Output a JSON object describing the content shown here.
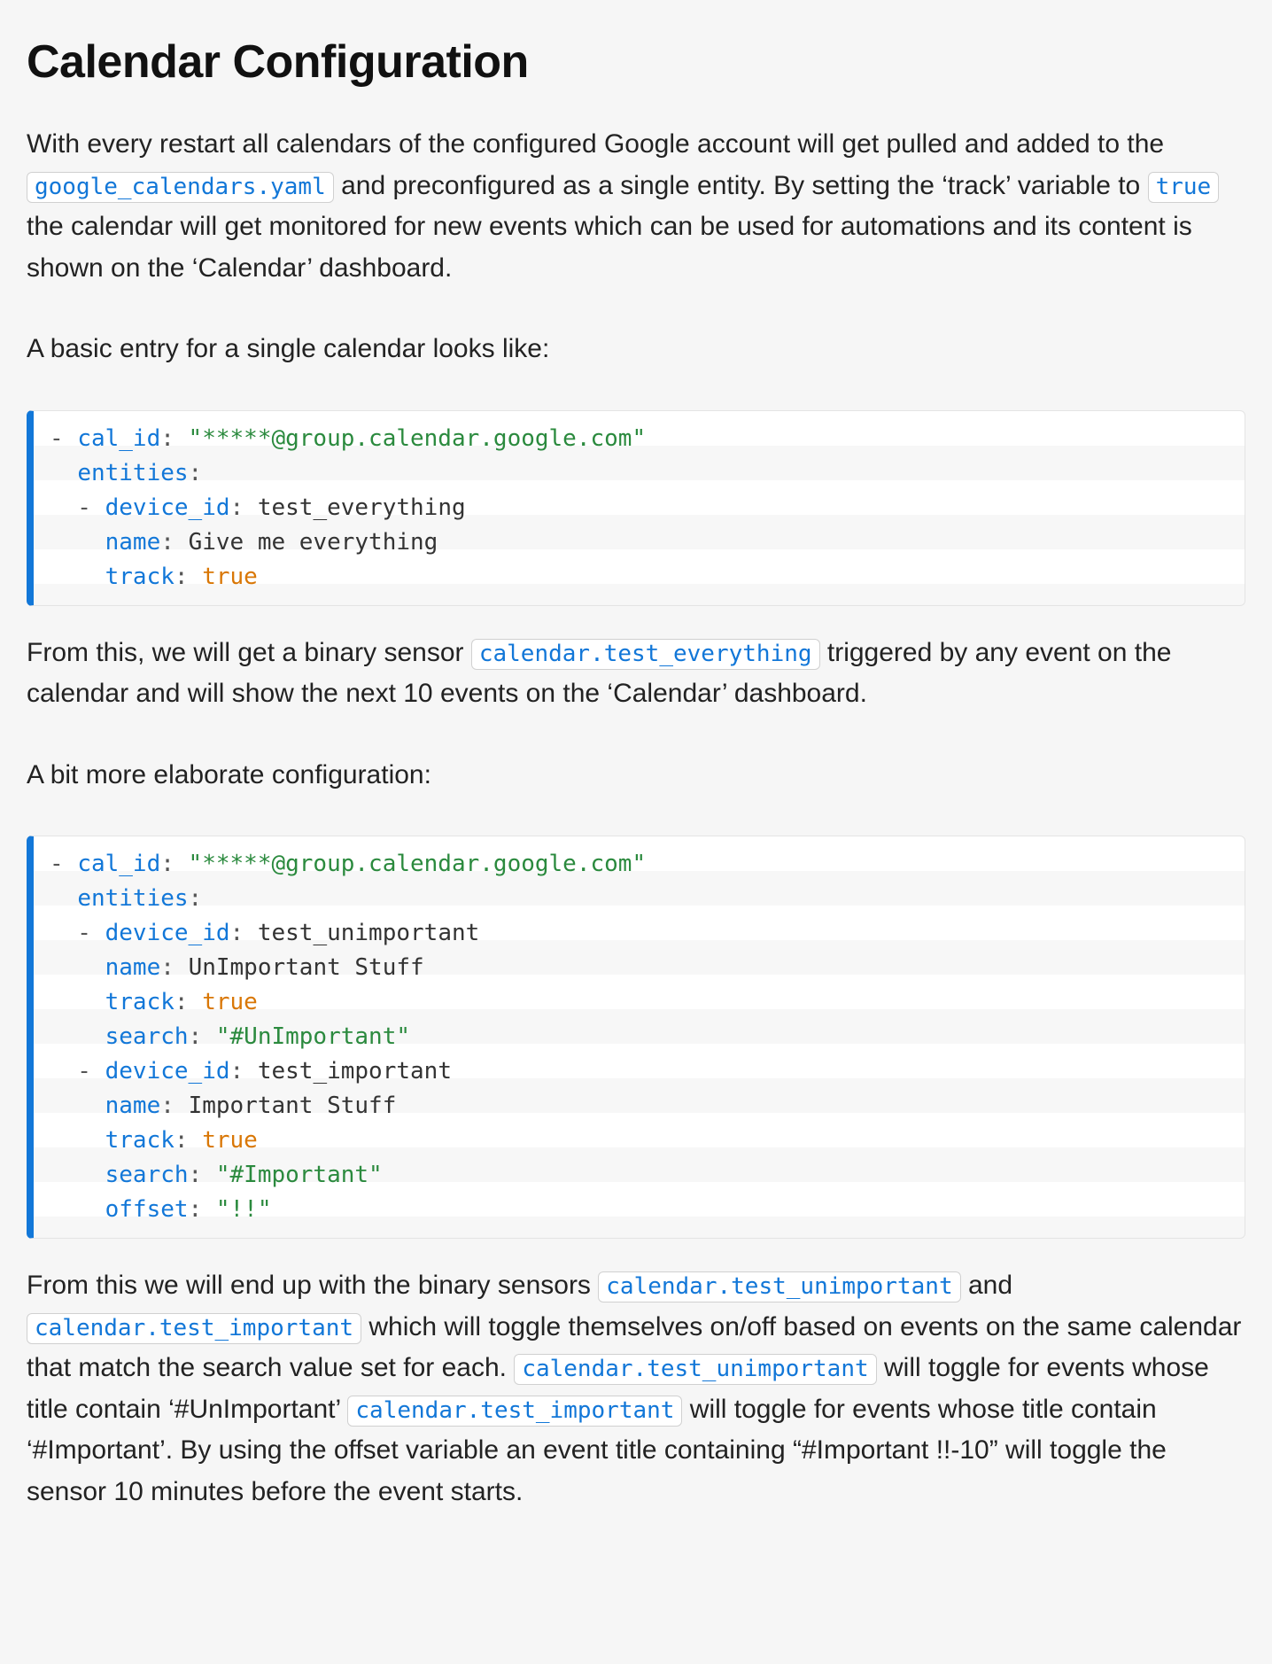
{
  "heading": "Calendar Configuration",
  "p1": {
    "t1": "With every restart all calendars of the configured Google account will get pulled and added to the ",
    "code1": "google_calendars.yaml",
    "t2": " and preconfigured as a single entity. By setting the ‘track’ variable to ",
    "code2": "true",
    "t3": " the calendar will get monitored for new events which can be used for automations and its content is shown on the ‘Calendar’ dashboard."
  },
  "p2": "A basic entry for a single calendar looks like:",
  "code_basic": {
    "dash": "- ",
    "k_cal_id": "cal_id",
    "colon": ":",
    "sp": " ",
    "v_cal_id": "\"*****@group.calendar.google.com\"",
    "k_entities": "entities",
    "dash2": "  - ",
    "k_device_id": "device_id",
    "v_device_id": "test_everything",
    "indent4": "    ",
    "k_name": "name",
    "v_name": "Give me everything",
    "k_track": "track",
    "v_track": "true"
  },
  "p3": {
    "t1": "From this, we will get a binary sensor ",
    "code1": "calendar.test_everything",
    "t2": " triggered by any event on the calendar and will show the next 10 events on the ‘Calendar’ dashboard."
  },
  "p4": "A bit more elaborate configuration:",
  "code_elab": {
    "dash": "- ",
    "k_cal_id": "cal_id",
    "colon": ":",
    "sp": " ",
    "v_cal_id": "\"*****@group.calendar.google.com\"",
    "k_entities": "entities",
    "dash2": "  - ",
    "indent4": "    ",
    "k_device_id": "device_id",
    "e1_device_id": "test_unimportant",
    "k_name": "name",
    "e1_name": "UnImportant Stuff",
    "k_track": "track",
    "e1_track": "true",
    "k_search": "search",
    "e1_search": "\"#UnImportant\"",
    "e2_device_id": "test_important",
    "e2_name": "Important Stuff",
    "e2_track": "true",
    "e2_search": "\"#Important\"",
    "k_offset": "offset",
    "e2_offset": "\"!!\""
  },
  "p5": {
    "t1": "From this we will end up with the binary sensors ",
    "code1": "calendar.test_unimportant",
    "t2": " and ",
    "code2": "calendar.test_important",
    "t3": " which will toggle themselves on/off based on events on the same calendar that match the search value set for each. ",
    "code3": "calendar.test_unimportant",
    "t4": " will toggle for events whose title contain ‘#UnImportant’ ",
    "code4": "calendar.test_important",
    "t5": " will toggle for events whose title contain ‘#Important’. By using the offset variable an event title containing “#Important !!-10” will toggle the sensor 10 minutes before the event starts."
  }
}
